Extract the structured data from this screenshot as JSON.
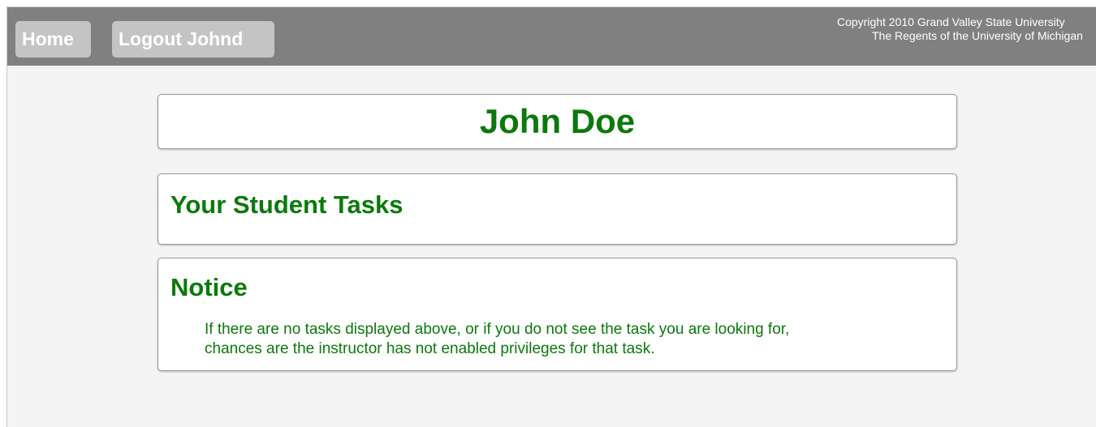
{
  "nav": {
    "home_label": "Home",
    "logout_label": "Logout Johnd"
  },
  "copyright": {
    "line1": "Copyright 2010 Grand Valley State University",
    "line2": "The Regents of the University of Michigan"
  },
  "profile": {
    "name": "John Doe"
  },
  "tasks": {
    "title": "Your Student Tasks"
  },
  "notice": {
    "title": "Notice",
    "line1": "If there are no tasks displayed above, or if you do not see the task you are looking for,",
    "line2": "chances are the instructor has not enabled privileges for that task."
  },
  "colors": {
    "topbar": "#808080",
    "button": "#c4c4c4",
    "accent_green": "#0a7a0a",
    "background": "#f4f4f4"
  }
}
